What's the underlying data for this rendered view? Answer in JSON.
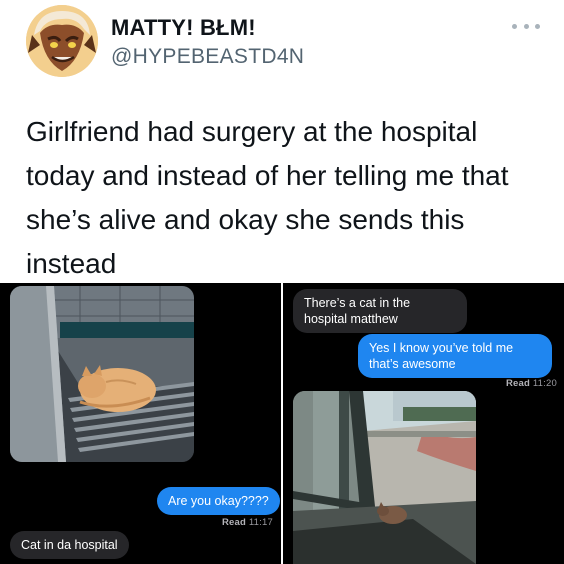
{
  "tweet": {
    "display_name": "MATTY! BŁM!",
    "handle": "@HYPEBEASTD4N",
    "text": "Girlfriend had surgery at the hospital today and instead of her telling me that she’s alive and okay she sends this instead",
    "avatar_icon": "cartoon-character-avatar",
    "more_icon": "more-horizontal-icon"
  },
  "left_screenshot": {
    "message_sent": "Are you okay????",
    "receipt_label": "Read",
    "receipt_time": "11:17",
    "message_received": "Cat in da hospital",
    "photo_description_icon": "cat-on-hospital-floor-photo"
  },
  "right_screenshot": {
    "message_received": "There’s a cat in the hospital matthew",
    "message_sent": "Yes I know you’ve told me that’s awesome",
    "receipt_label": "Read",
    "receipt_time": "11:20",
    "photo_description_icon": "cat-by-hospital-window-photo"
  },
  "colors": {
    "imessage_blue": "#1f86f0",
    "imessage_gray": "#262629",
    "background": "#000000",
    "handle_gray": "#536471"
  }
}
